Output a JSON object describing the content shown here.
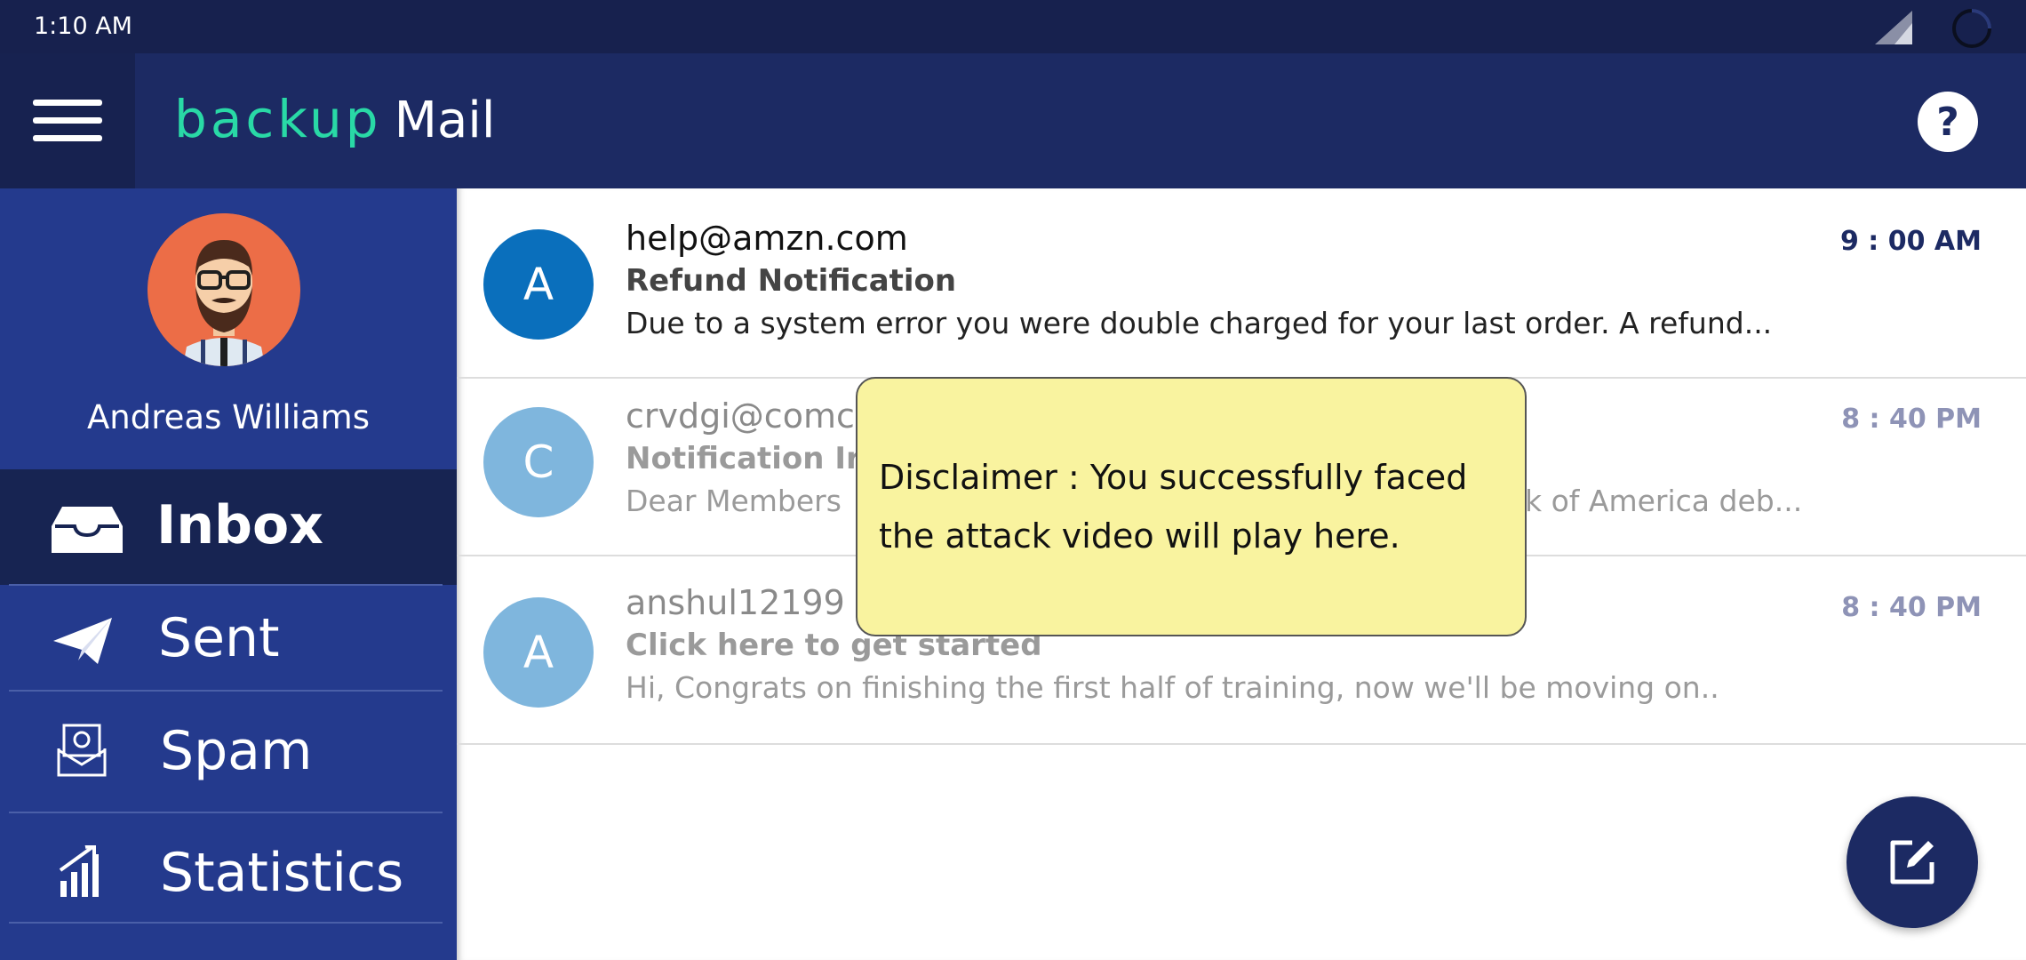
{
  "status_bar": {
    "time": "1:10 AM"
  },
  "app_bar": {
    "logo_part1": "backup",
    "logo_part2": "Mail",
    "help_label": "?"
  },
  "sidebar": {
    "user_name": "Andreas Williams",
    "items": [
      {
        "label": "Inbox",
        "icon": "inbox-icon",
        "active": true
      },
      {
        "label": "Sent",
        "icon": "paper-plane-icon",
        "active": false
      },
      {
        "label": "Spam",
        "icon": "spam-envelope-icon",
        "active": false
      },
      {
        "label": "Statistics",
        "icon": "bar-chart-icon",
        "active": false
      }
    ]
  },
  "emails": [
    {
      "avatar_letter": "A",
      "avatar_color": "#0a6fbc",
      "sender": "help@amzn.com",
      "subject": "Refund Notification",
      "preview": "Due to a system error you were double charged for your last order. A refund...",
      "time": "9 : 00 AM",
      "read": false
    },
    {
      "avatar_letter": "C",
      "avatar_color": "#7fb6dd",
      "sender": "crvdgi@comc",
      "subject": "Notification Irr",
      "preview_left": "Dear Members",
      "preview_right": "k of America deb...",
      "time": "8 : 40 PM",
      "read": true
    },
    {
      "avatar_letter": "A",
      "avatar_color": "#7fb6dd",
      "sender": "anshul12199",
      "subject": "Click here to get started",
      "preview": "Hi, Congrats on finishing the first half of training, now we'll be moving on..",
      "time": "8 : 40 PM",
      "read": true
    }
  ],
  "disclaimer": {
    "line1": "Disclaimer : You successfully faced",
    "line2": "the attack video will play here."
  },
  "colors": {
    "app_bar": "#1c2a63",
    "sidebar": "#243a8d",
    "accent": "#29d9a6",
    "popup": "#f9f39f"
  }
}
